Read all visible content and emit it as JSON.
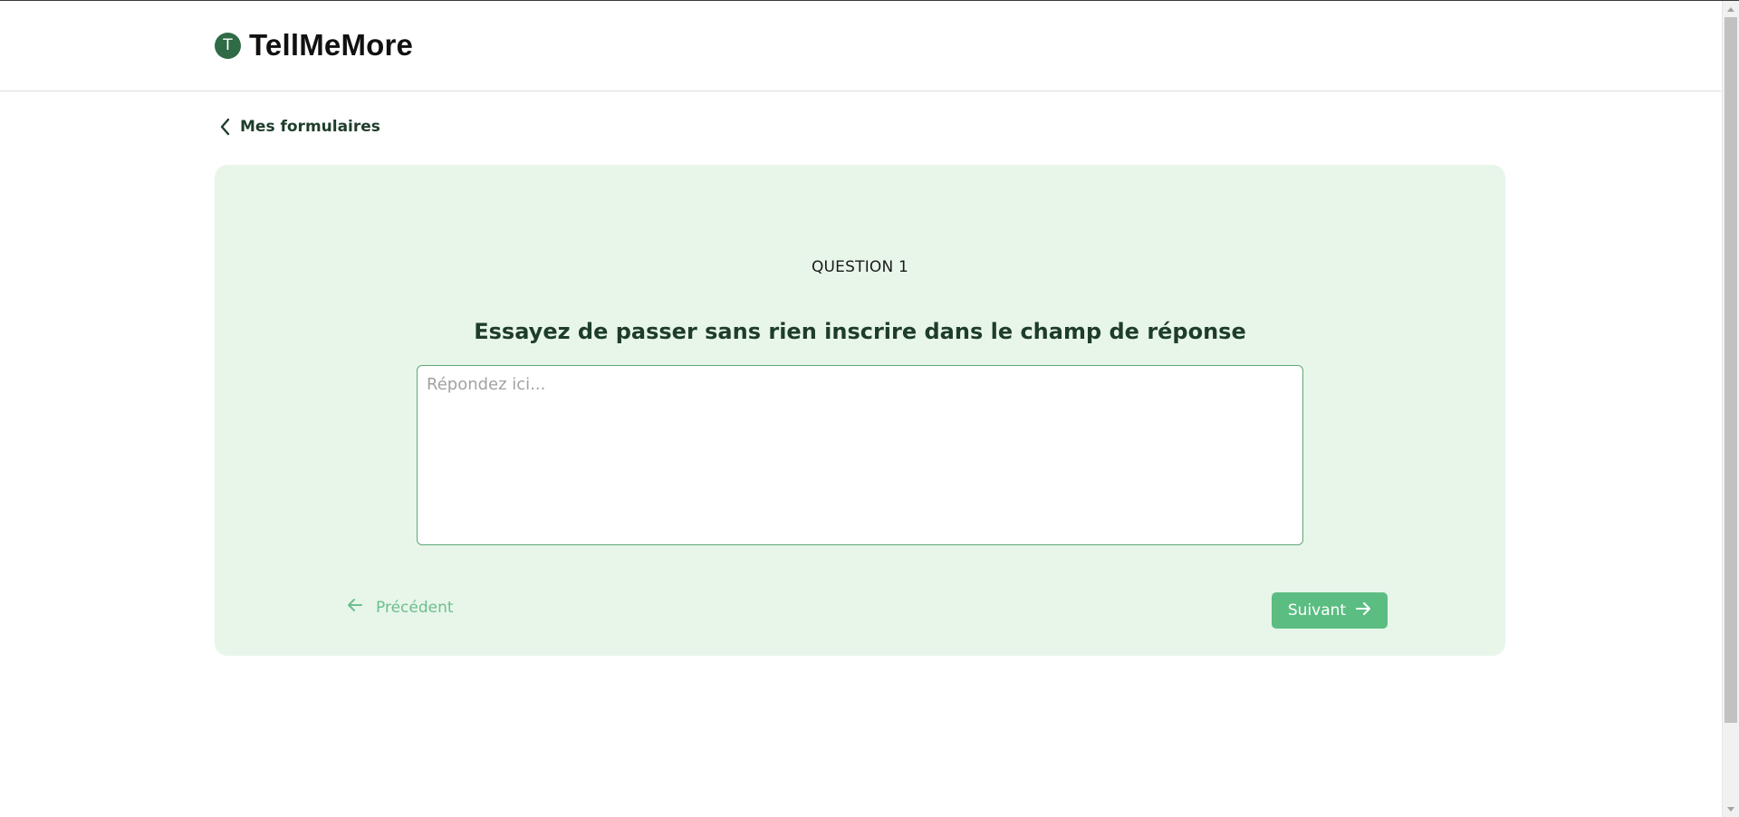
{
  "header": {
    "logo_letter": "T",
    "brand_name": "TellMeMore"
  },
  "nav": {
    "back_label": "Mes formulaires"
  },
  "question": {
    "number_label": "QUESTION 1",
    "title": "Essayez de passer sans rien inscrire dans le champ de réponse",
    "answer_value": "",
    "answer_placeholder": "Répondez ici..."
  },
  "navigation": {
    "prev_label": "Précédent",
    "next_label": "Suivant"
  },
  "colors": {
    "brand_green": "#2f6b45",
    "card_background": "#e8f6ea",
    "primary_button": "#5cbd82",
    "disabled_prev": "#6cbf8c",
    "text_dark_green": "#1e3d29"
  },
  "icons": {
    "back": "chevron-left-icon",
    "prev": "arrow-left-icon",
    "next": "arrow-right-icon"
  }
}
